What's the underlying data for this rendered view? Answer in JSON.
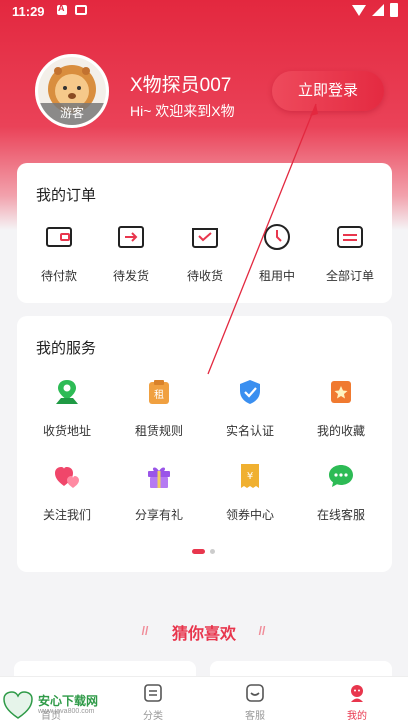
{
  "status_bar": {
    "time": "11:29"
  },
  "profile": {
    "guest_tag": "游客",
    "username": "X物探员007",
    "welcome": "Hi~ 欢迎来到X物",
    "login_button": "立即登录"
  },
  "orders": {
    "title": "我的订单",
    "items": [
      {
        "label": "待付款",
        "icon": "wallet-icon"
      },
      {
        "label": "待发货",
        "icon": "send-box-icon"
      },
      {
        "label": "待收货",
        "icon": "receive-box-icon"
      },
      {
        "label": "租用中",
        "icon": "clock-icon"
      },
      {
        "label": "全部订单",
        "icon": "orders-list-icon"
      }
    ]
  },
  "services": {
    "title": "我的服务",
    "items": [
      {
        "label": "收货地址",
        "icon": "location-icon",
        "color": "#2dbb55"
      },
      {
        "label": "租赁规则",
        "icon": "rent-rules-icon",
        "color": "#f0a040"
      },
      {
        "label": "实名认证",
        "icon": "shield-check-icon",
        "color": "#3a8ff0"
      },
      {
        "label": "我的收藏",
        "icon": "star-bookmark-icon",
        "color": "#f07a30"
      },
      {
        "label": "关注我们",
        "icon": "hearts-icon",
        "color": "#f0466a"
      },
      {
        "label": "分享有礼",
        "icon": "gift-icon",
        "color": "#9a55e8"
      },
      {
        "label": "领券中心",
        "icon": "coupon-icon",
        "color": "#f0b030"
      },
      {
        "label": "在线客服",
        "icon": "chat-icon",
        "color": "#2dbb55"
      }
    ],
    "pager": {
      "pages": 2,
      "current": 1
    }
  },
  "recommend": {
    "title": "猜你喜欢"
  },
  "tabbar": {
    "items": [
      {
        "label": "首页",
        "icon": "home-icon"
      },
      {
        "label": "分类",
        "icon": "category-icon"
      },
      {
        "label": "客服",
        "icon": "service-icon"
      },
      {
        "label": "我的",
        "icon": "mine-icon"
      }
    ],
    "active": 3
  },
  "watermark": {
    "name": "安心下载网",
    "url": "www.java800.com"
  },
  "colors": {
    "brand": "#e3283f",
    "accent": "#e8364d"
  }
}
